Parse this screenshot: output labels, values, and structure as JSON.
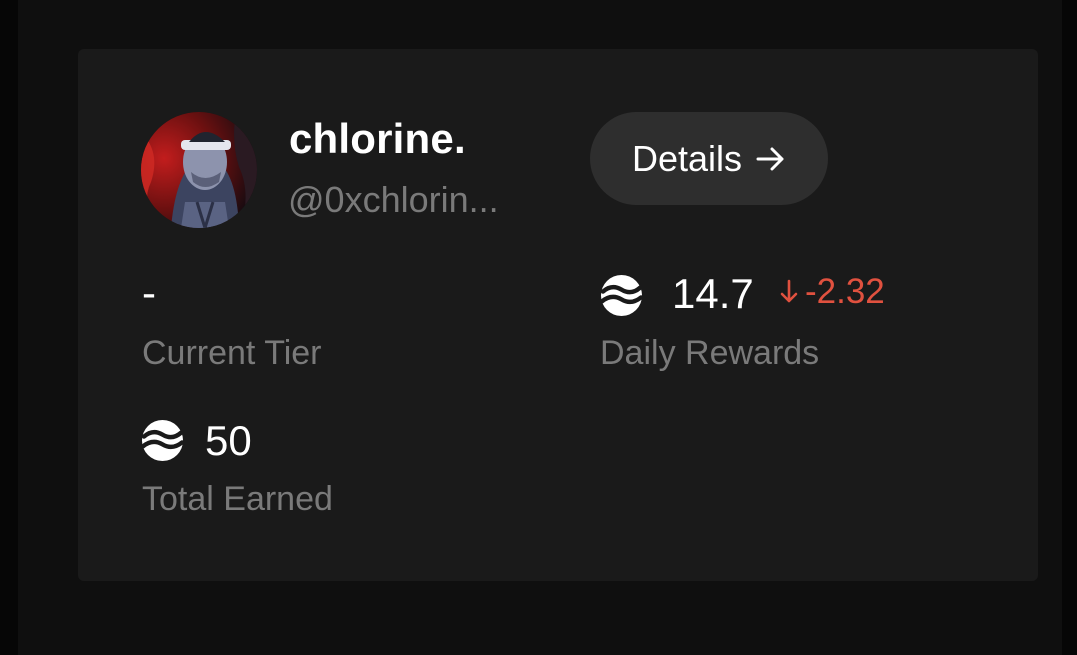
{
  "profile": {
    "display_name": "chlorine.",
    "handle": "@0xchlorin..."
  },
  "details_button": {
    "label": "Details",
    "icon": "arrow-right-icon"
  },
  "stats": {
    "current_tier": {
      "value": "-",
      "label": "Current Tier"
    },
    "daily_rewards": {
      "value": "14.7",
      "change": "-2.32",
      "change_direction": "down",
      "label": "Daily Rewards",
      "icon": "token-icon"
    },
    "total_earned": {
      "value": "50",
      "label": "Total Earned",
      "icon": "token-icon"
    }
  },
  "colors": {
    "background": "#060606",
    "panel": "#0f0f0f",
    "card": "#1a1a1a",
    "button": "#2e2e2e",
    "text_primary": "#ffffff",
    "text_secondary": "#7a7a7a",
    "negative": "#e0513f"
  }
}
